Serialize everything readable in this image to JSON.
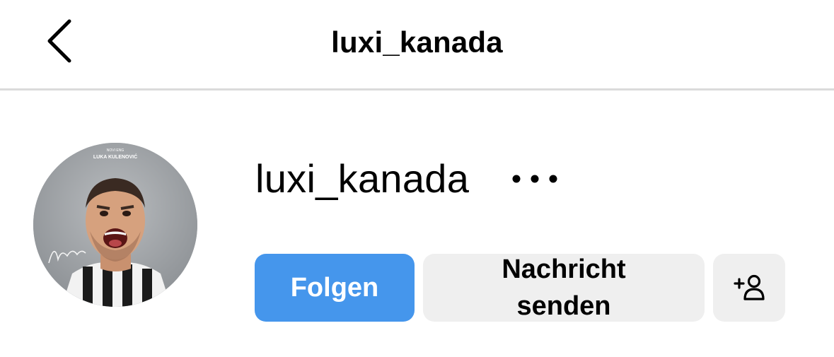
{
  "header": {
    "title": "luxi_kanada"
  },
  "profile": {
    "username": "luxi_kanada",
    "avatar": {
      "top_line": "NOVI ENG",
      "name": "LUKA KULENOVIĆ"
    }
  },
  "actions": {
    "follow_label": "Folgen",
    "message_line1": "Nachricht",
    "message_line2": "senden"
  },
  "colors": {
    "follow_bg": "#4596ec",
    "button_bg": "#efefef",
    "divider": "#dbdbdb"
  },
  "icons": {
    "back": "chevron-left-icon",
    "more": "more-dots-icon",
    "add_user": "add-user-icon"
  }
}
